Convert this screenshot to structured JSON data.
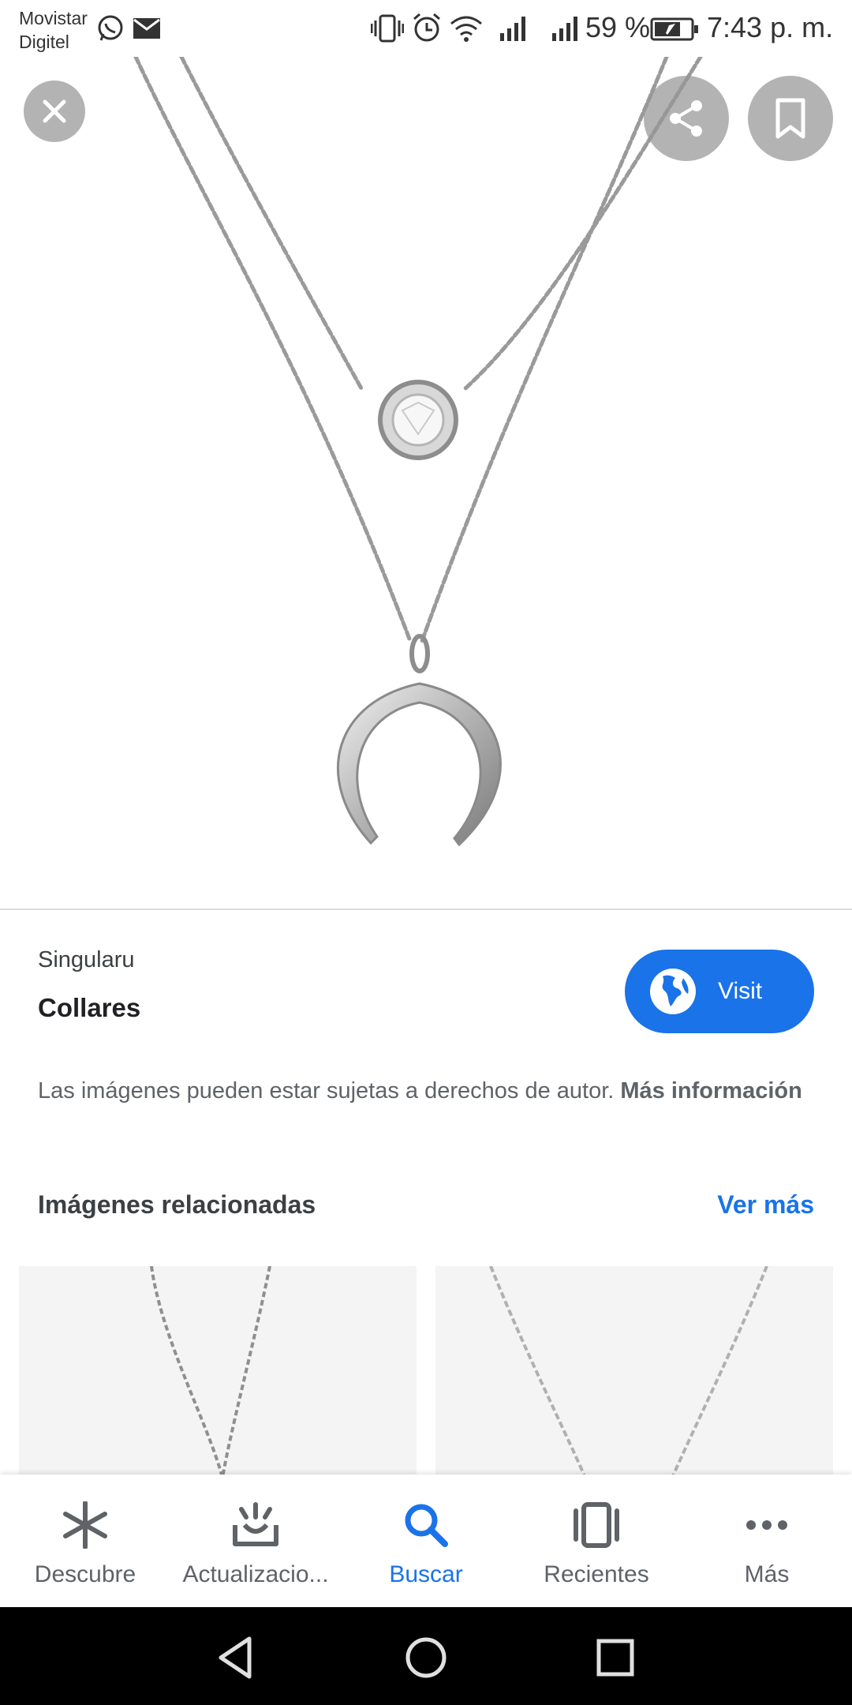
{
  "status_bar": {
    "carrier_line1": "Movistar",
    "carrier_line2": "Digitel",
    "battery_text": "59 %",
    "time": "7:43 p. m.",
    "icons": [
      "whatsapp-icon",
      "mail-icon",
      "vibrate-icon",
      "alarm-icon",
      "wifi-icon",
      "signal-icon",
      "signal-icon",
      "battery-icon"
    ]
  },
  "viewer": {
    "close_icon": "close-icon",
    "share_icon": "share-icon",
    "save_icon": "bookmark-icon"
  },
  "info": {
    "source": "Singularu",
    "title": "Collares",
    "visit_label": "Visit",
    "copyright_text": "Las imágenes pueden estar sujetas a derechos de autor.",
    "copyright_link": "Más información"
  },
  "related": {
    "title": "Imágenes relacionadas",
    "see_more": "Ver más"
  },
  "bottom_nav": {
    "items": [
      {
        "label": "Descubre",
        "icon": "asterisk-icon"
      },
      {
        "label": "Actualizacio...",
        "icon": "updates-icon"
      },
      {
        "label": "Buscar",
        "icon": "search-icon"
      },
      {
        "label": "Recientes",
        "icon": "recents-icon"
      },
      {
        "label": "Más",
        "icon": "more-icon"
      }
    ],
    "active_index": 2
  },
  "colors": {
    "accent": "#1a73e8",
    "nav_inactive": "#5f6368"
  }
}
